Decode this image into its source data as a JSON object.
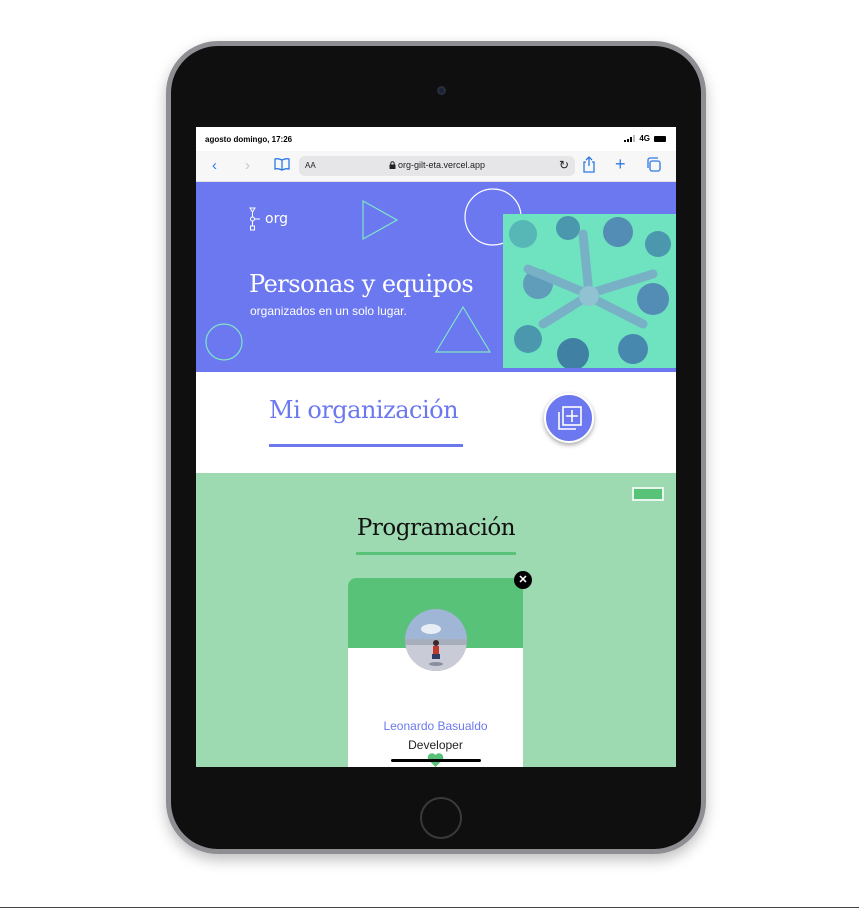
{
  "status": {
    "time": "agosto domingo, 17:26",
    "network": "4G"
  },
  "browser": {
    "reader_label": "AA",
    "url": "org-gilt-eta.vercel.app"
  },
  "hero": {
    "logo_text": "org",
    "title": "Personas y equipos",
    "subtitle": "organizados en un solo lugar."
  },
  "organization": {
    "title": "Mi organización"
  },
  "team": {
    "title": "Programación",
    "primary_color": "#57c278",
    "secondary_color": "#9ddab1",
    "members": [
      {
        "name": "Leonardo Basualdo",
        "role": "Developer"
      }
    ]
  },
  "colors": {
    "accent": "#6b78f0",
    "hero_bg": "#6b78f0",
    "photo_tint": "#6fe3c1"
  },
  "icons": {
    "back": "chevron-left-icon",
    "forward": "chevron-right-icon",
    "bookmarks": "book-icon",
    "lock": "lock-icon",
    "reload": "reload-icon",
    "share": "share-icon",
    "new_tab": "plus-icon",
    "tabs": "tabs-icon",
    "add_collaborator": "add-collaborator-icon",
    "close": "close-icon",
    "favorite": "heart-icon"
  }
}
